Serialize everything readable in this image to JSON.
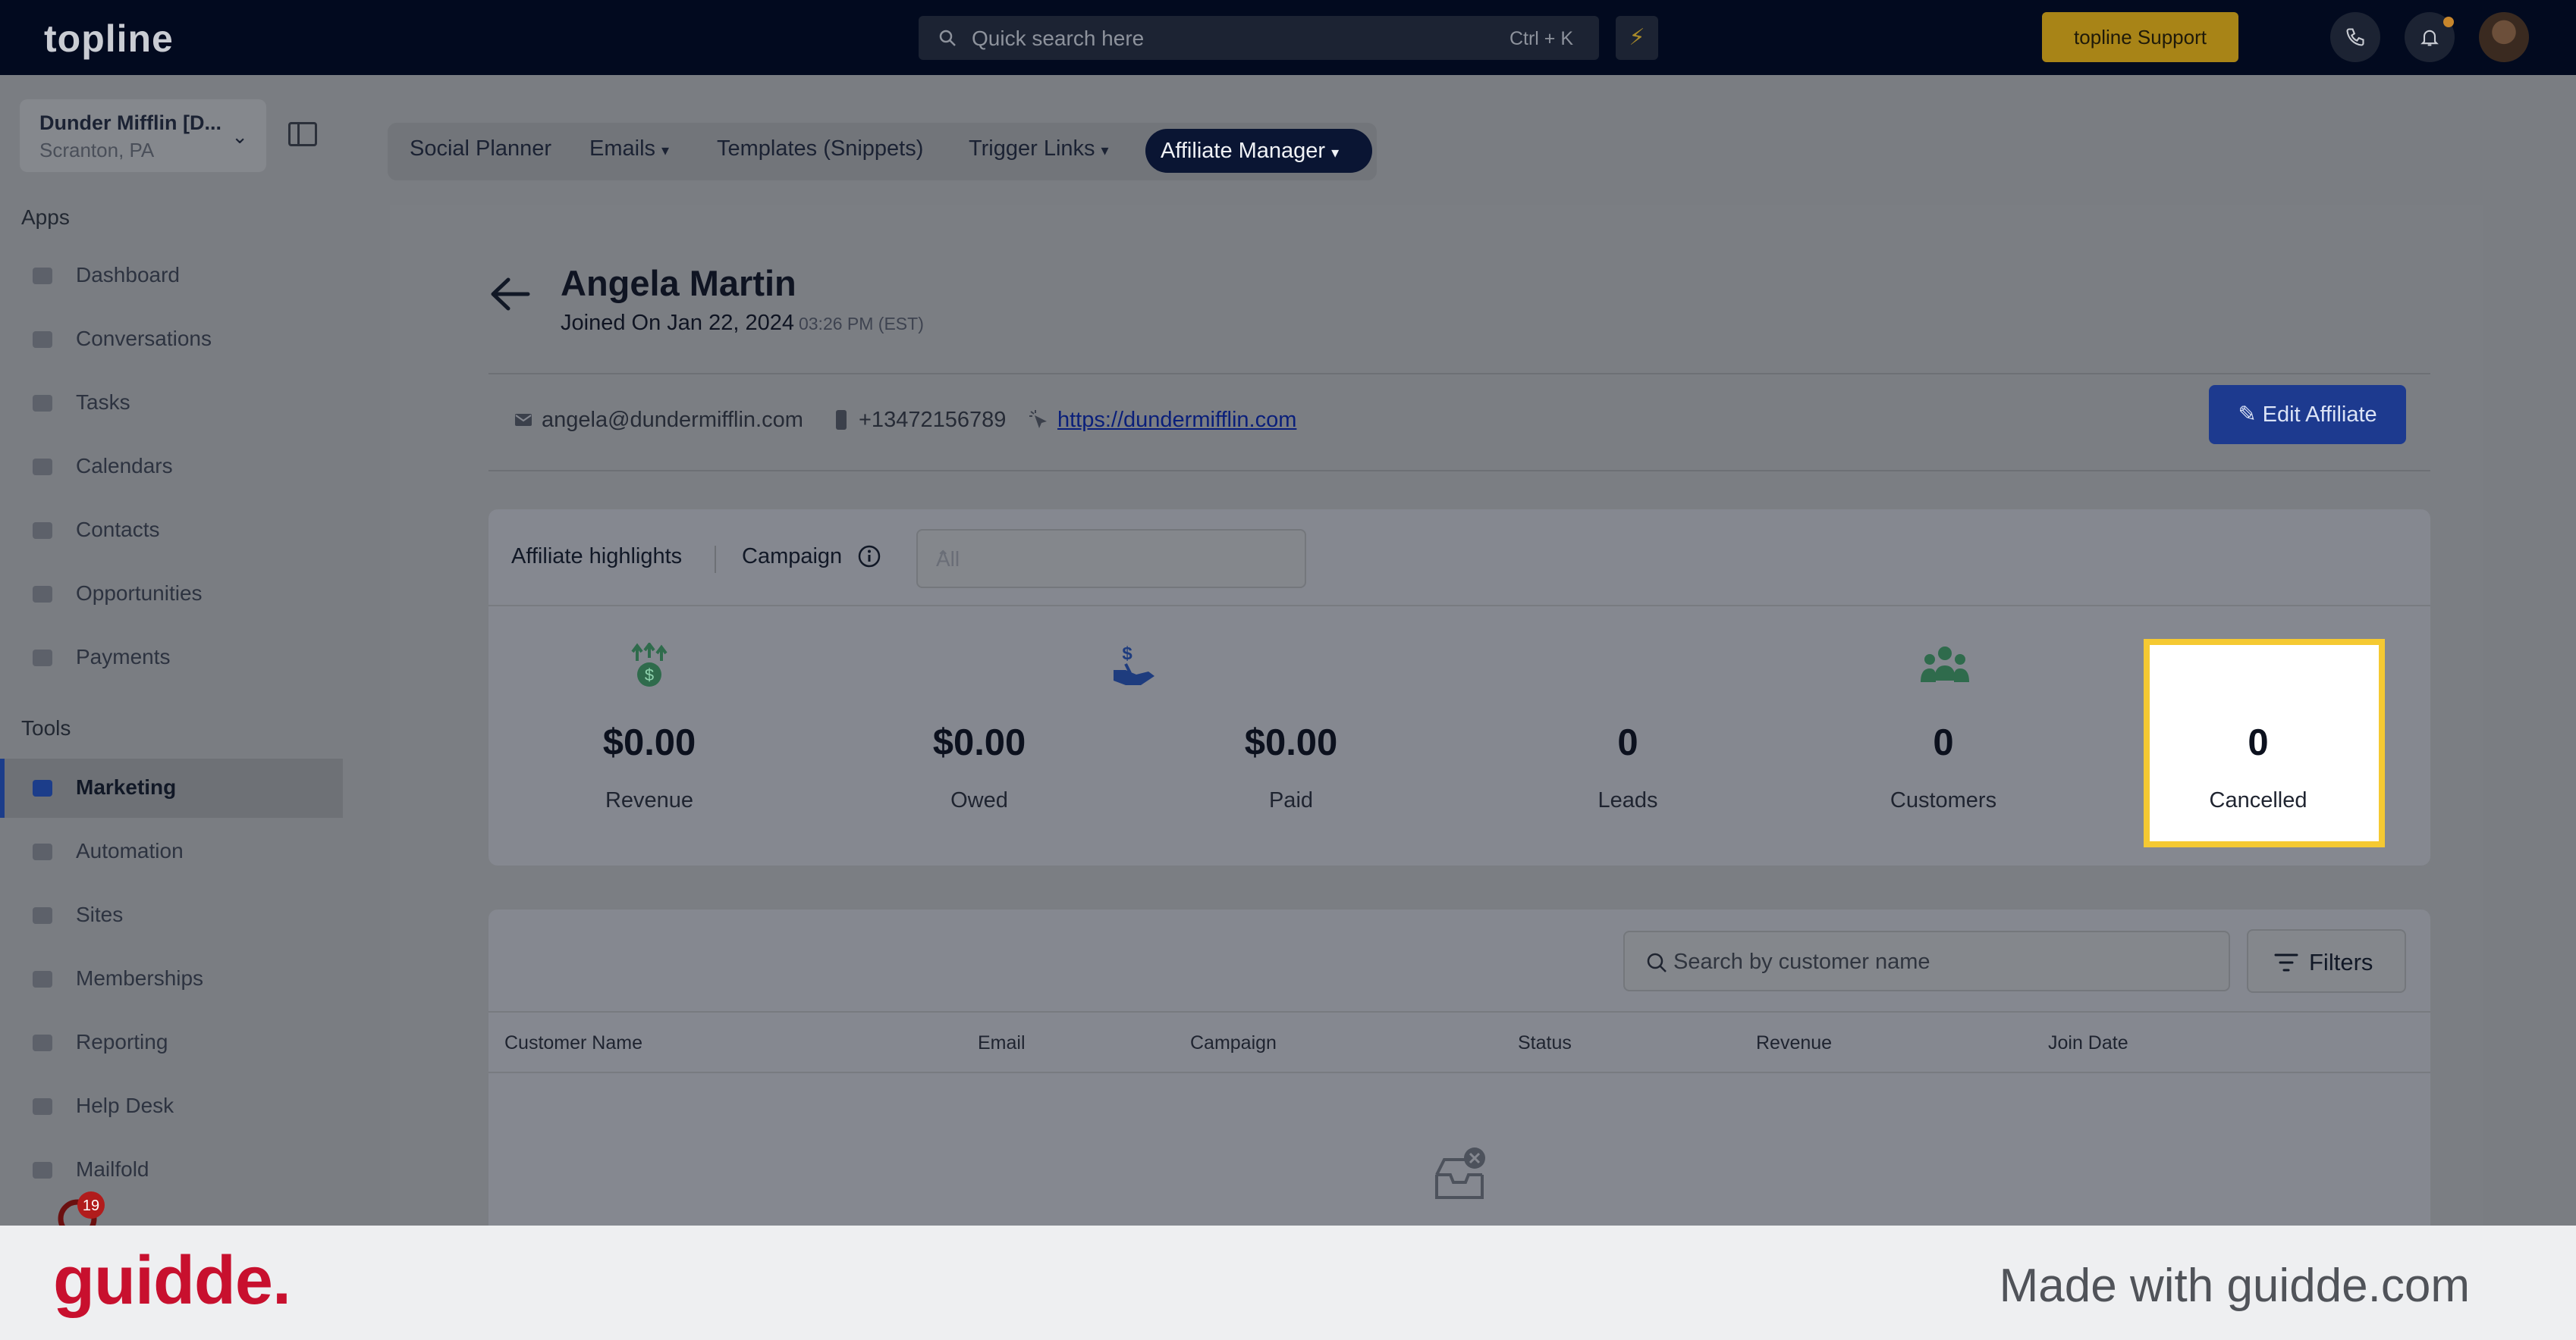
{
  "topbar": {
    "logo": "topline",
    "search_placeholder": "Quick search here",
    "search_shortcut": "Ctrl + K",
    "support_label": "topline Support"
  },
  "sidebar": {
    "location_name": "Dunder Mifflin [D...",
    "location_city": "Scranton, PA",
    "apps_title": "Apps",
    "apps": [
      {
        "label": "Dashboard",
        "icon": "dashboard-icon"
      },
      {
        "label": "Conversations",
        "icon": "chat-icon"
      },
      {
        "label": "Tasks",
        "icon": "tasks-icon"
      },
      {
        "label": "Calendars",
        "icon": "calendar-icon"
      },
      {
        "label": "Contacts",
        "icon": "person-icon"
      },
      {
        "label": "Opportunities",
        "icon": "target-icon"
      },
      {
        "label": "Payments",
        "icon": "card-icon"
      }
    ],
    "tools_title": "Tools",
    "tools": [
      {
        "label": "Marketing",
        "icon": "megaphone-icon",
        "active": true
      },
      {
        "label": "Automation",
        "icon": "gears-icon"
      },
      {
        "label": "Sites",
        "icon": "globe-icon"
      },
      {
        "label": "Memberships",
        "icon": "members-icon"
      },
      {
        "label": "Reporting",
        "icon": "pie-chart-icon"
      },
      {
        "label": "Help Desk",
        "icon": "help-icon"
      },
      {
        "label": "Mailfold",
        "icon": "mail-icon"
      }
    ],
    "badge_count": "19"
  },
  "subnav": {
    "tabs": [
      {
        "label": "Social Planner",
        "dropdown": false
      },
      {
        "label": "Emails",
        "dropdown": true
      },
      {
        "label": "Templates (Snippets)",
        "dropdown": false
      },
      {
        "label": "Trigger Links",
        "dropdown": true
      },
      {
        "label": "Affiliate Manager",
        "dropdown": true,
        "active": true
      }
    ]
  },
  "affiliate": {
    "name": "Angela Martin",
    "joined_prefix": "Joined On Jan 22, 2024",
    "joined_time": "03:26 PM (EST)",
    "email": "angela@dundermifflin.com",
    "phone": "+13472156789",
    "website": "https://dundermifflin.com",
    "edit_label": "Edit Affiliate"
  },
  "highlights": {
    "title": "Affiliate highlights",
    "campaign_label": "Campaign",
    "campaign_value": "All",
    "stats": [
      {
        "value": "$0.00",
        "label": "Revenue",
        "icon": "money-growth-icon"
      },
      {
        "value": "$0.00",
        "label": "Owed",
        "icon": ""
      },
      {
        "value": "$0.00",
        "label": "Paid",
        "icon": "hand-dollar-icon"
      },
      {
        "value": "0",
        "label": "Leads",
        "icon": ""
      },
      {
        "value": "0",
        "label": "Customers",
        "icon": "group-icon"
      },
      {
        "value": "0",
        "label": "Cancelled",
        "icon": ""
      }
    ]
  },
  "table": {
    "search_placeholder": "Search by customer name",
    "filters_label": "Filters",
    "columns": [
      "Customer Name",
      "Email",
      "Campaign",
      "Status",
      "Revenue",
      "Join Date"
    ]
  },
  "footer": {
    "logo": "guidde.",
    "made_with": "Made with guidde.com"
  },
  "colors": {
    "highlight_border": "#f5c932",
    "accent_blue": "#1d3a8f",
    "guidde_red": "#c8102e"
  }
}
